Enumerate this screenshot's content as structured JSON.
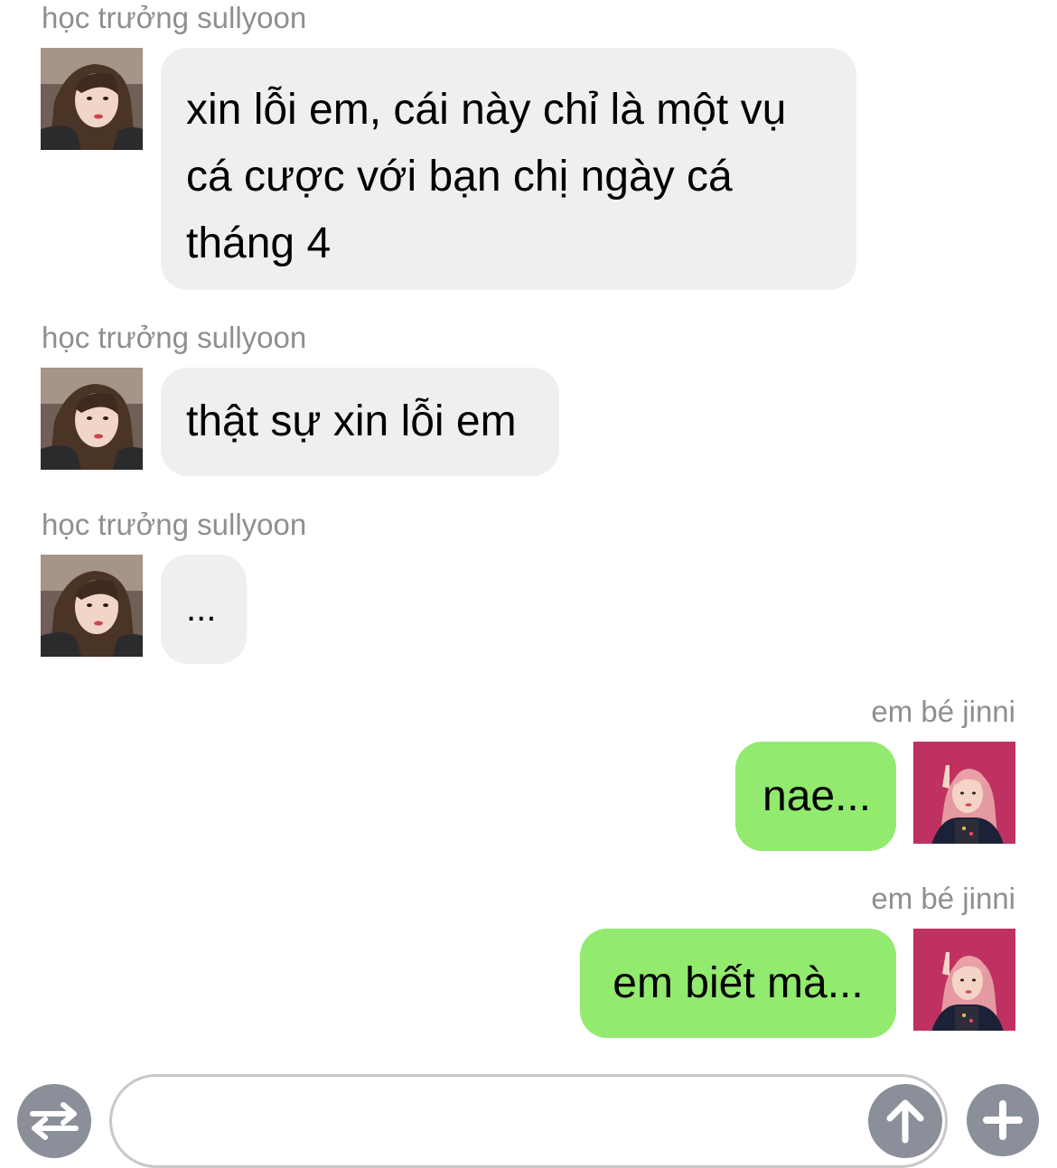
{
  "messages": [
    {
      "sender": "học trưởng sullyoon",
      "text": "xin lỗi em, cái này chỉ là một vụ\ncá cược với bạn chị ngày cá\ntháng 4",
      "direction": "incoming"
    },
    {
      "sender": "học trưởng sullyoon",
      "text": "thật sự xin lỗi em",
      "direction": "incoming"
    },
    {
      "sender": "học trưởng sullyoon",
      "text": "...",
      "direction": "incoming"
    },
    {
      "sender": "em bé jinni",
      "text": "nae...",
      "direction": "outgoing"
    },
    {
      "sender": "em bé jinni",
      "text": "em biết mà...",
      "direction": "outgoing"
    }
  ],
  "composer": {
    "input_value": "",
    "left_button_icon": "swap-arrows-icon",
    "send_button_icon": "arrow-up-icon",
    "right_button_icon": "plus-icon"
  },
  "colors": {
    "incoming_bubble": "#efefef",
    "outgoing_bubble": "#92ea6f",
    "sender_name": "#8e8e93",
    "button_gray": "#8b8f99"
  }
}
